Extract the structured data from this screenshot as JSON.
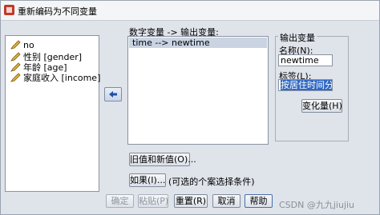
{
  "window": {
    "title": "重新编码为不同变量"
  },
  "source_variables": [
    {
      "label": "no"
    },
    {
      "label": "性别 [gender]"
    },
    {
      "label": "年龄 [age]"
    },
    {
      "label": "家庭收入 [income]"
    }
  ],
  "mapping": {
    "header": "数字变量 -> 输出变量:",
    "rows": [
      "time --> newtime"
    ]
  },
  "output_variable": {
    "group_title": "输出变量",
    "name_label": "名称(N):",
    "name_value": "newtime",
    "label_label": "标签(L):",
    "label_value": "按居住时间分组",
    "change_button": "变化量(H)"
  },
  "buttons": {
    "old_new": "旧值和新值(O)...",
    "if": "如果(I)...",
    "if_note": "(可选的个案选择条件)",
    "ok": "确定",
    "paste": "粘贴(P)",
    "reset": "重置(R)",
    "cancel": "取消",
    "help": "帮助"
  },
  "watermark": "CSDN @九九jiujiu",
  "colors": {
    "dialog_bg": "#dfe3ea",
    "selection": "#316ac5",
    "mapping_highlight": "#c9d3e2"
  }
}
